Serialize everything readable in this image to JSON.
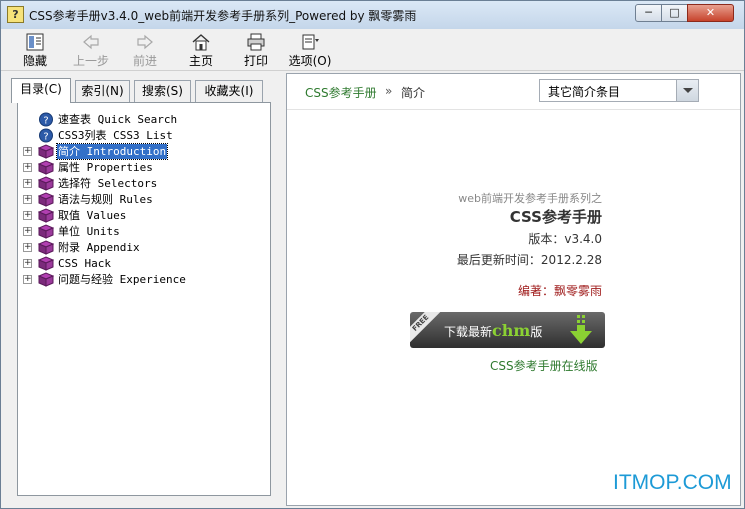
{
  "window": {
    "title": "CSS参考手册v3.4.0_web前端开发参考手册系列_Powered by 飘零雾雨",
    "app_icon_glyph": "?",
    "controls": {
      "minimize": "─",
      "maximize": "□",
      "close": "✕"
    }
  },
  "toolbar": {
    "buttons": [
      {
        "label": "隐藏",
        "icon": "hide-icon",
        "enabled": true
      },
      {
        "label": "上一步",
        "icon": "back-arrow-icon",
        "enabled": false
      },
      {
        "label": "前进",
        "icon": "forward-arrow-icon",
        "enabled": false
      },
      {
        "label": "主页",
        "icon": "home-icon",
        "enabled": true
      },
      {
        "label": "打印",
        "icon": "printer-icon",
        "enabled": true
      },
      {
        "label": "选项(O)",
        "icon": "options-icon",
        "enabled": true
      }
    ]
  },
  "left_tabs": [
    {
      "label": "目录(C)",
      "active": true
    },
    {
      "label": "索引(N)",
      "active": false
    },
    {
      "label": "搜索(S)",
      "active": false
    },
    {
      "label": "收藏夹(I)",
      "active": false
    }
  ],
  "tree": [
    {
      "label": "速查表 Quick Search",
      "icon": "help-page-icon",
      "expandable": false,
      "selected": false
    },
    {
      "label": "CSS3列表 CSS3 List",
      "icon": "help-page-icon",
      "expandable": false,
      "selected": false
    },
    {
      "label": "简介 Introduction",
      "icon": "book-icon",
      "expandable": true,
      "selected": true
    },
    {
      "label": "属性 Properties",
      "icon": "book-icon",
      "expandable": true,
      "selected": false
    },
    {
      "label": "选择符 Selectors",
      "icon": "book-icon",
      "expandable": true,
      "selected": false
    },
    {
      "label": "语法与规则 Rules",
      "icon": "book-icon",
      "expandable": true,
      "selected": false
    },
    {
      "label": "取值 Values",
      "icon": "book-icon",
      "expandable": true,
      "selected": false
    },
    {
      "label": "单位 Units",
      "icon": "book-icon",
      "expandable": true,
      "selected": false
    },
    {
      "label": "附录 Appendix",
      "icon": "book-icon",
      "expandable": true,
      "selected": false
    },
    {
      "label": "CSS Hack",
      "icon": "book-icon",
      "expandable": true,
      "selected": false
    },
    {
      "label": "问题与经验 Experience",
      "icon": "book-icon",
      "expandable": true,
      "selected": false
    }
  ],
  "content": {
    "breadcrumb": {
      "root": "CSS参考手册",
      "separator": "»",
      "current": "简介"
    },
    "dropdown": {
      "selected": "其它简介条目"
    },
    "subtitle": "web前端开发参考手册系列之",
    "title": "CSS参考手册",
    "version": "版本：v3.4.0",
    "updated": "最后更新时间：2012.2.28",
    "author": "编著：飘零雾雨",
    "download": {
      "ribbon": "FREE",
      "prefix": "下载最新",
      "chm": "chm",
      "suffix": "版"
    },
    "online_link": "CSS参考手册在线版"
  },
  "watermark": "ITMOP.COM",
  "colors": {
    "link_green": "#2f7a2f",
    "author_red": "#a01e1e",
    "selection_blue": "#3370c8",
    "watermark_blue": "#1d9ad6"
  }
}
